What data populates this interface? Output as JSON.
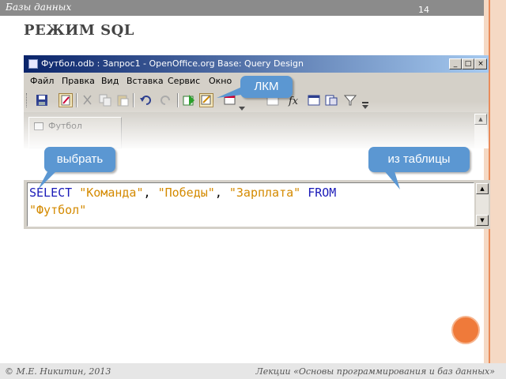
{
  "slide": {
    "section": "Базы данных",
    "number": "14",
    "heading": "РЕЖИМ SQL",
    "footer_left": "© М.Е. Никитин, 2013",
    "footer_right": "Лекции «Основы программирования и баз данных»"
  },
  "window": {
    "title": "Футбол.odb : Запрос1 - OpenOffice.org Base: Query Design",
    "buttons": {
      "minimize": "_",
      "maximize": "□",
      "close": "×"
    },
    "menu": [
      "Файл",
      "Правка",
      "Вид",
      "Вставка",
      "Сервис",
      "Окно"
    ],
    "toolbar_icons": [
      "save-icon",
      "edit-icon",
      "cut-icon",
      "copy-icon",
      "paste-icon",
      "undo-icon",
      "redo-icon",
      "run-query-icon",
      "design-view-icon",
      "add-table-icon",
      "functions-icon",
      "table-names-icon",
      "aliases-icon",
      "filter-icon"
    ],
    "table_widget": {
      "name": "Футбол"
    }
  },
  "sql": {
    "line1": {
      "select": "SELECT",
      "col1": "\"Команда\"",
      "comma1": ",",
      "col2": "\"Победы\"",
      "comma2": ",",
      "col3": "\"Зарплата\"",
      "from": "FROM"
    },
    "line2": {
      "table": "\"Футбол\""
    }
  },
  "callouts": {
    "lkm": "ЛКМ",
    "select": "выбрать",
    "from_table": "из таблицы"
  },
  "colors": {
    "keyword": "#1a1ab8",
    "string": "#d48a00",
    "callout": "#5b97d2",
    "accent": "#ef7a3a"
  }
}
